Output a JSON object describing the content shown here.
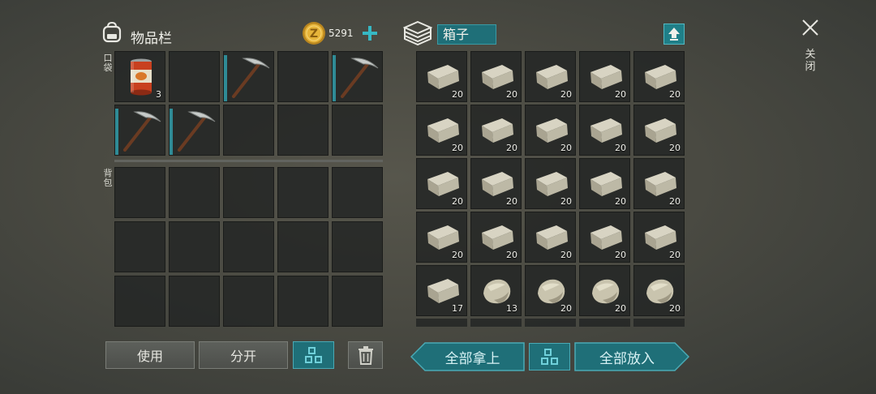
{
  "inventory": {
    "title": "物品栏",
    "currency": "5291",
    "pocket_label": [
      "口",
      "袋"
    ],
    "backpack_label": [
      "背",
      "包"
    ],
    "pocket_slots": [
      {
        "item": "food-can",
        "qty": "3"
      },
      {
        "item": "",
        "qty": ""
      },
      {
        "item": "pickaxe",
        "qty": ""
      },
      {
        "item": "",
        "qty": ""
      },
      {
        "item": "pickaxe",
        "qty": ""
      },
      {
        "item": "pickaxe",
        "qty": ""
      },
      {
        "item": "pickaxe",
        "qty": ""
      },
      {
        "item": "",
        "qty": ""
      },
      {
        "item": "",
        "qty": ""
      },
      {
        "item": "",
        "qty": ""
      }
    ],
    "use_label": "使用",
    "split_label": "分开"
  },
  "container": {
    "title": "箱子",
    "slots": [
      {
        "item": "stone-brick",
        "qty": "20"
      },
      {
        "item": "stone-brick",
        "qty": "20"
      },
      {
        "item": "stone-brick",
        "qty": "20"
      },
      {
        "item": "stone-brick",
        "qty": "20"
      },
      {
        "item": "stone-brick",
        "qty": "20"
      },
      {
        "item": "stone-brick",
        "qty": "20"
      },
      {
        "item": "stone-brick",
        "qty": "20"
      },
      {
        "item": "stone-brick",
        "qty": "20"
      },
      {
        "item": "stone-brick",
        "qty": "20"
      },
      {
        "item": "stone-brick",
        "qty": "20"
      },
      {
        "item": "stone-brick",
        "qty": "20"
      },
      {
        "item": "stone-brick",
        "qty": "20"
      },
      {
        "item": "stone-brick",
        "qty": "20"
      },
      {
        "item": "stone-brick",
        "qty": "20"
      },
      {
        "item": "stone-brick",
        "qty": "20"
      },
      {
        "item": "stone-brick",
        "qty": "20"
      },
      {
        "item": "stone-brick",
        "qty": "20"
      },
      {
        "item": "stone-brick",
        "qty": "20"
      },
      {
        "item": "stone-brick",
        "qty": "20"
      },
      {
        "item": "stone-brick",
        "qty": "20"
      },
      {
        "item": "stone-brick",
        "qty": "17"
      },
      {
        "item": "stone-rock",
        "qty": "13"
      },
      {
        "item": "stone-rock",
        "qty": "20"
      },
      {
        "item": "stone-rock",
        "qty": "20"
      },
      {
        "item": "stone-rock",
        "qty": "20"
      }
    ],
    "take_all_label": "全部拿上",
    "put_all_label": "全部放入"
  },
  "close_label": [
    "关",
    "闭"
  ],
  "colors": {
    "accent": "#1f6f78",
    "accent_border": "#4aaab5",
    "equip_bar": "#2f8b96",
    "coin": "#e6b43a"
  }
}
